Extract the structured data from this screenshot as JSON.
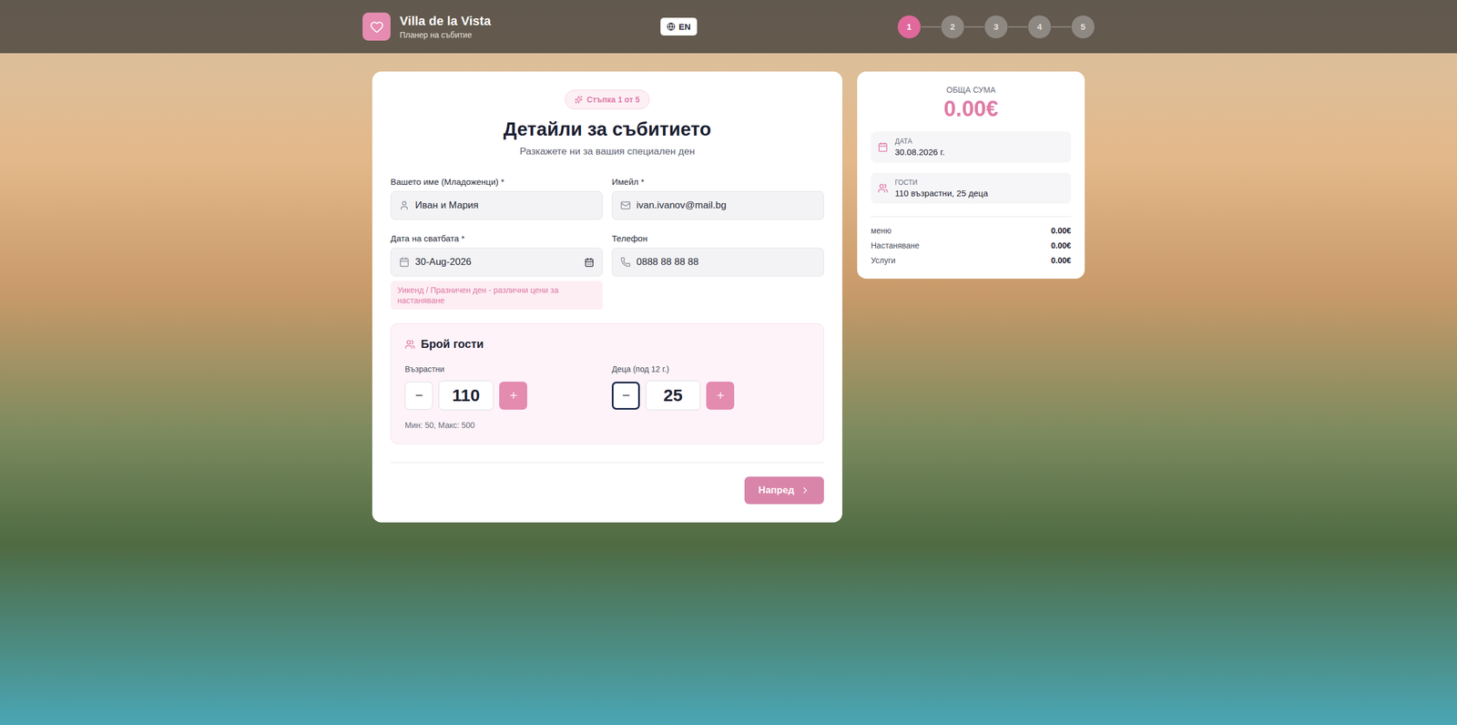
{
  "header": {
    "title": "Villa de la Vista",
    "subtitle": "Планер на събитие",
    "language": "EN",
    "steps": [
      {
        "label": "1",
        "selected": true
      },
      {
        "label": "2",
        "selected": false
      },
      {
        "label": "3",
        "selected": false
      },
      {
        "label": "4",
        "selected": false
      },
      {
        "label": "5",
        "selected": false
      }
    ]
  },
  "form": {
    "badge": "Стъпка 1 от 5",
    "title": "Детайли за събитието",
    "subtitle": "Разкажете ни за вашия специален ден",
    "fields": [
      {
        "kind": "name",
        "label": "Вашето име (Младоженци) *",
        "value": "Иван и Мария"
      },
      {
        "kind": "email",
        "label": "Имейл *",
        "value": "ivan.ivanov@mail.bg"
      },
      {
        "kind": "date",
        "label": "Дата на сватбата *",
        "value": "30-Aug-2026",
        "warning": "Уикенд / Празничен ден - различни цени за настаняване"
      },
      {
        "kind": "phone",
        "label": "Телефон",
        "value": "0888 88 88 88"
      }
    ],
    "guests": {
      "title": "Брой гости",
      "counters": [
        {
          "label": "Възрастни",
          "value": "110",
          "focused": false
        },
        {
          "label": "Деца (под 12 г.)",
          "value": "25",
          "focused": true
        }
      ],
      "hint": "Мин: 50, Макс: 500"
    },
    "next": "Напред"
  },
  "summary": {
    "total_label": "ОБЩА СУМА",
    "total": "0.00€",
    "info": [
      {
        "kind": "date",
        "label": "ДАТА",
        "value": "30.08.2026 г."
      },
      {
        "kind": "guests",
        "label": "ГОСТИ",
        "value": "110 възрастни, 25 деца"
      }
    ],
    "lines": [
      {
        "label": "меню",
        "amount": "0.00€"
      },
      {
        "label": "Настаняване",
        "amount": "0.00€"
      },
      {
        "label": "Услуги",
        "amount": "0.00€"
      }
    ]
  }
}
